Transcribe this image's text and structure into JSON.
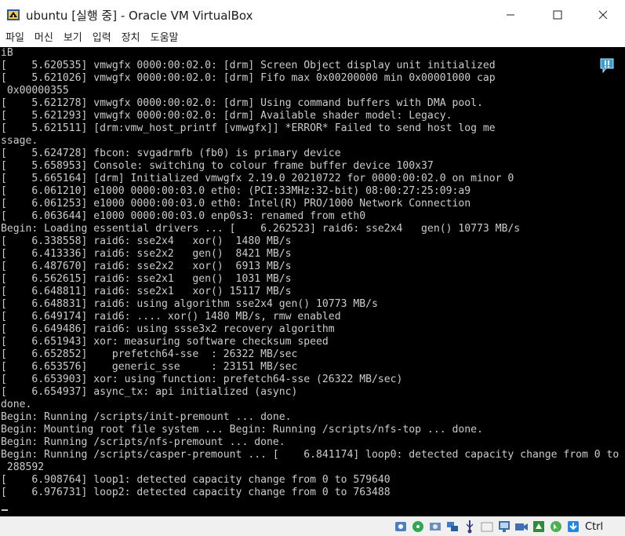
{
  "window": {
    "title": "ubuntu [실행 중] - Oracle VM VirtualBox",
    "controls": {
      "minimize": "─",
      "maximize": "☐",
      "close": "✕"
    }
  },
  "menu": [
    "파일",
    "머신",
    "보기",
    "입력",
    "장치",
    "도움말"
  ],
  "console": {
    "lines": [
      "iB",
      "[    5.620535] vmwgfx 0000:00:02.0: [drm] Screen Object display unit initialized",
      "[    5.621026] vmwgfx 0000:00:02.0: [drm] Fifo max 0x00200000 min 0x00001000 cap",
      " 0x00000355",
      "[    5.621278] vmwgfx 0000:00:02.0: [drm] Using command buffers with DMA pool.",
      "[    5.621293] vmwgfx 0000:00:02.0: [drm] Available shader model: Legacy.",
      "[    5.621511] [drm:vmw_host_printf [vmwgfx]] *ERROR* Failed to send host log me",
      "ssage.",
      "[    5.624728] fbcon: svgadrmfb (fb0) is primary device",
      "[    5.658953] Console: switching to colour frame buffer device 100x37",
      "[    5.665164] [drm] Initialized vmwgfx 2.19.0 20210722 for 0000:00:02.0 on minor 0",
      "[    6.061210] e1000 0000:00:03.0 eth0: (PCI:33MHz:32-bit) 08:00:27:25:09:a9",
      "[    6.061253] e1000 0000:00:03.0 eth0: Intel(R) PRO/1000 Network Connection",
      "[    6.063644] e1000 0000:00:03.0 enp0s3: renamed from eth0",
      "Begin: Loading essential drivers ... [    6.262523] raid6: sse2x4   gen() 10773 MB/s",
      "[    6.338558] raid6: sse2x4   xor()  1480 MB/s",
      "[    6.413336] raid6: sse2x2   gen()  8421 MB/s",
      "[    6.487670] raid6: sse2x2   xor()  6913 MB/s",
      "[    6.562615] raid6: sse2x1   gen()  1031 MB/s",
      "[    6.648811] raid6: sse2x1   xor() 15117 MB/s",
      "[    6.648831] raid6: using algorithm sse2x4 gen() 10773 MB/s",
      "[    6.649174] raid6: .... xor() 1480 MB/s, rmw enabled",
      "[    6.649486] raid6: using ssse3x2 recovery algorithm",
      "[    6.651943] xor: measuring software checksum speed",
      "[    6.652852]    prefetch64-sse  : 26322 MB/sec",
      "[    6.653576]    generic_sse     : 23151 MB/sec",
      "[    6.653903] xor: using function: prefetch64-sse (26322 MB/sec)",
      "[    6.654937] async_tx: api initialized (async)",
      "done.",
      "Begin: Running /scripts/init-premount ... done.",
      "Begin: Mounting root file system ... Begin: Running /scripts/nfs-top ... done.",
      "Begin: Running /scripts/nfs-premount ... done.",
      "Begin: Running /scripts/casper-premount ... [    6.841174] loop0: detected capacity change from 0 to",
      " 288592",
      "[    6.908764] loop1: detected capacity change from 0 to 579640",
      "[    6.976731] loop2: detected capacity change from 0 to 763488"
    ]
  },
  "statusbar": {
    "icons": [
      "hard-disk-icon",
      "optical-drive-icon",
      "audio-icon",
      "network-icon",
      "usb-icon",
      "shared-folder-icon",
      "display-icon",
      "video-capture-icon",
      "virtualization-icon",
      "mouse-integration-icon",
      "keyboard-capture-icon"
    ],
    "host_key": "Ctrl"
  },
  "colors": {
    "console_bg": "#000000",
    "console_fg": "#cccccc",
    "accent": "#1e90c8"
  }
}
